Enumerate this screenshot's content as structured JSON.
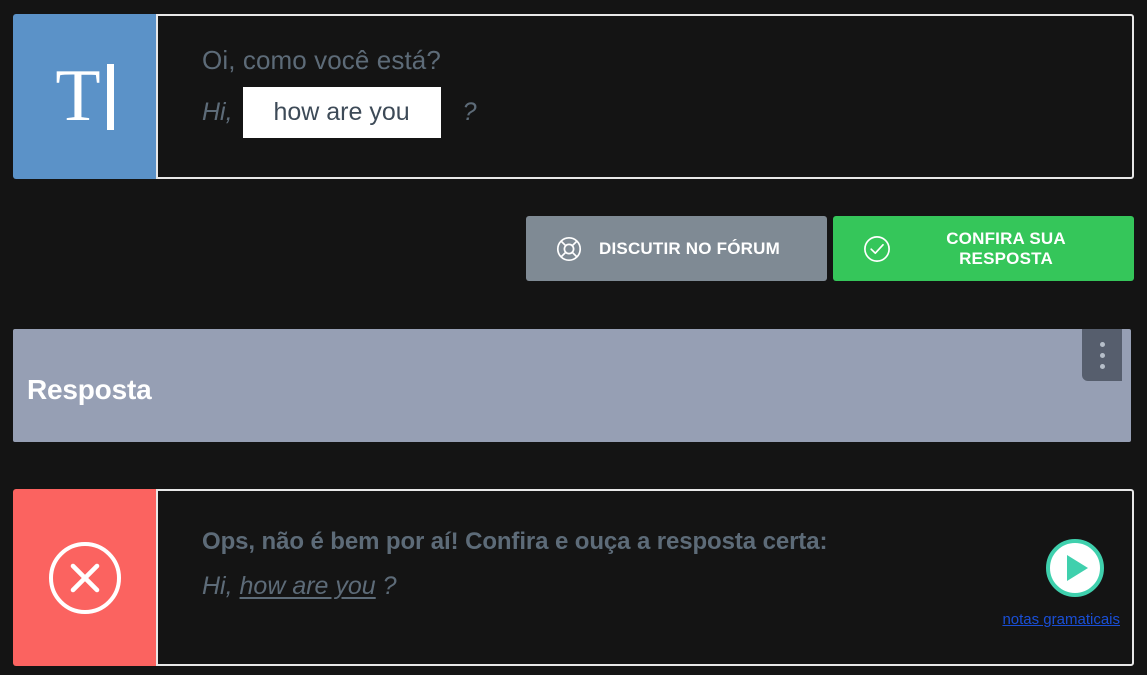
{
  "question_card": {
    "icon": "text-input-icon",
    "icon_letter": "T",
    "prompt_native": "Oi, como você está?",
    "answer_prefix": "Hi,",
    "answer_value": "how are you",
    "answer_placeholder": "",
    "answer_suffix": "?"
  },
  "actions": {
    "forum": {
      "label": "DISCUTIR NO FÓRUM",
      "icon": "lifebuoy-icon",
      "color": "#7f8a94"
    },
    "check": {
      "label": "CONFIRA SUA RESPOSTA",
      "icon": "check-circle-icon",
      "color": "#35c65a"
    }
  },
  "answer_section": {
    "title": "Resposta",
    "menu_icon": "kebab-menu-icon",
    "bar_color": "#969fb4"
  },
  "feedback_card": {
    "status_icon": "x-circle-icon",
    "status_color": "#fb6360",
    "heading": "Ops, não é bem por aí! Confira e ouça a resposta certa:",
    "answer_prefix": "Hi,",
    "answer_highlight": "how are you",
    "answer_suffix": "?",
    "play_icon": "play-icon",
    "play_color": "#3fd0ad",
    "notes_link": "notas gramaticais",
    "link_color": "#1a4fd6"
  }
}
